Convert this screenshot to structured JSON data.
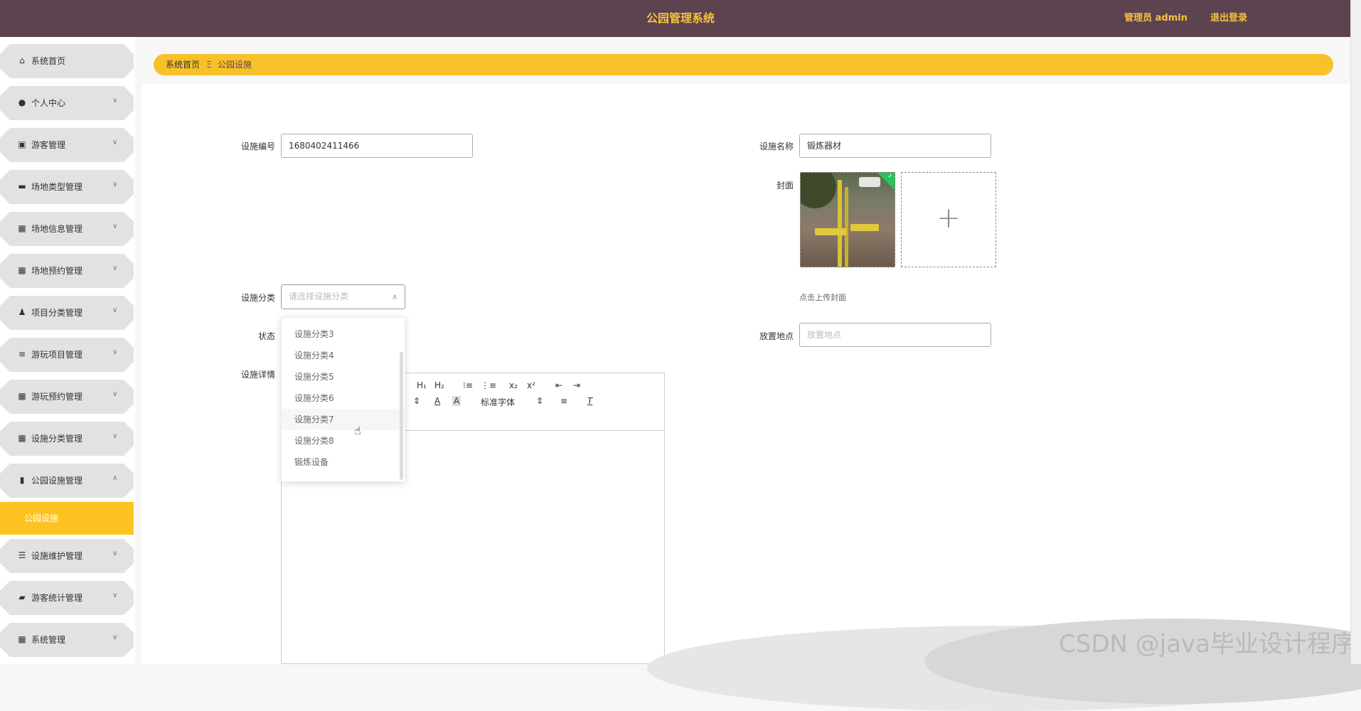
{
  "header": {
    "title": "公园管理系统",
    "user_label": "管理员 admin",
    "logout_label": "退出登录"
  },
  "sidebar": {
    "items": [
      {
        "label": "系统首页",
        "icon": "home-icon",
        "chevron": false
      },
      {
        "label": "个人中心",
        "icon": "user-icon",
        "chevron": true
      },
      {
        "label": "游客管理",
        "icon": "clipboard-icon",
        "chevron": true
      },
      {
        "label": "场地类型管理",
        "icon": "monitor-icon",
        "chevron": true
      },
      {
        "label": "场地信息管理",
        "icon": "grid-icon",
        "chevron": true
      },
      {
        "label": "场地预约管理",
        "icon": "grid-icon",
        "chevron": true
      },
      {
        "label": "项目分类管理",
        "icon": "person-icon",
        "chevron": true
      },
      {
        "label": "游玩项目管理",
        "icon": "list-icon",
        "chevron": true
      },
      {
        "label": "游玩预约管理",
        "icon": "grid-icon",
        "chevron": true
      },
      {
        "label": "设施分类管理",
        "icon": "grid-icon",
        "chevron": true
      },
      {
        "label": "公园设施管理",
        "icon": "bar-chart-icon",
        "chevron": true
      },
      {
        "label": "设施维护管理",
        "icon": "sliders-icon",
        "chevron": true
      },
      {
        "label": "游客统计管理",
        "icon": "briefcase-icon",
        "chevron": true
      },
      {
        "label": "系统管理",
        "icon": "grid-icon",
        "chevron": true
      }
    ],
    "active_sub": "公园设施"
  },
  "breadcrumb": {
    "home": "系统首页",
    "sep": "Ξ",
    "current": "公园设施"
  },
  "form": {
    "code_label": "设施编号",
    "code_value": "1680402411466",
    "name_label": "设施名称",
    "name_value": "锻炼器材",
    "cover_label": "封面",
    "cover_hint": "点击上传封面",
    "category_label": "设施分类",
    "category_placeholder": "请选择设施分类",
    "status_label": "状态",
    "location_label": "放置地点",
    "location_placeholder": "放置地点",
    "detail_label": "设施详情"
  },
  "dropdown": {
    "options": [
      "设施分类3",
      "设施分类4",
      "设施分类5",
      "设施分类6",
      "设施分类7",
      "设施分类8",
      "锻炼设备"
    ],
    "hover_index": 4
  },
  "editor": {
    "toolbar": {
      "h1": "H₁",
      "h2": "H₂",
      "sub": "x₂",
      "sup": "x²",
      "font": "标准字体"
    }
  },
  "watermark": "CSDN @java毕业设计程序"
}
